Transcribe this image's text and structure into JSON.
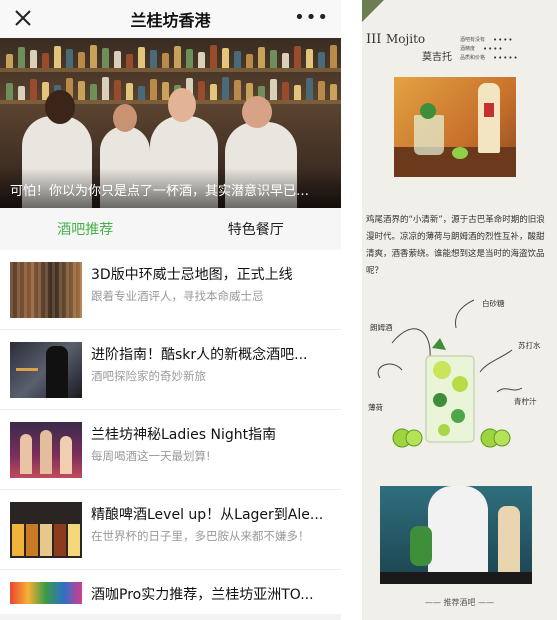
{
  "left": {
    "header": {
      "title": "兰桂坊香港",
      "close_icon": "close-icon",
      "more_icon": "more-icon",
      "more_label": "•••"
    },
    "hero": {
      "caption": "可怕！你以为你只是点了一杯酒，其实潜意识早已…"
    },
    "tabs": [
      {
        "label": "酒吧推荐",
        "active": true
      },
      {
        "label": "特色餐厅",
        "active": false
      }
    ],
    "articles": [
      {
        "title": "3D版中环威士忌地图，正式上线",
        "subtitle": "跟着专业酒评人，寻找本命威士忌"
      },
      {
        "title": "进阶指南！酷skr人的新概念酒吧...",
        "subtitle": "酒吧探险家的奇妙新旅"
      },
      {
        "title": "兰桂坊神秘Ladies Night指南",
        "subtitle": "每周喝酒这一天最划算!"
      },
      {
        "title": "精酿啤酒Level up！从Lager到Ale...",
        "subtitle": "在世界杯的日子里，多巴胺从来都不嫌多！"
      },
      {
        "title": "酒咖Pro实力推荐，兰桂坊亚洲TO...",
        "subtitle": ""
      }
    ]
  },
  "right": {
    "section_num": "III",
    "name_en": "Mojito",
    "name_cn": "莫吉托",
    "specs": [
      {
        "label": "酒吧有没有",
        "rating": "••••"
      },
      {
        "label": "酒精度",
        "rating": "••••"
      },
      {
        "label": "品质和价格",
        "rating": "•••••"
      }
    ],
    "description": "鸡尾酒界的“小清新”，源于古巴革命时期的旧浪漫时代。凉凉的薄荷与朗姆酒的烈性互补，酸甜清爽，酒香萦绕。谁能想到这是当时的海盗饮品呢？",
    "ingredients": {
      "sugar": "白砂糖",
      "rum": "朗姆酒",
      "soda": "苏打水",
      "mint": "薄荷",
      "lime": "青柠汁"
    },
    "bottom_caption": "—— 推荐酒吧 ——"
  },
  "colors": {
    "accent_green": "#46b04a",
    "corner_green": "#6d7c52"
  }
}
